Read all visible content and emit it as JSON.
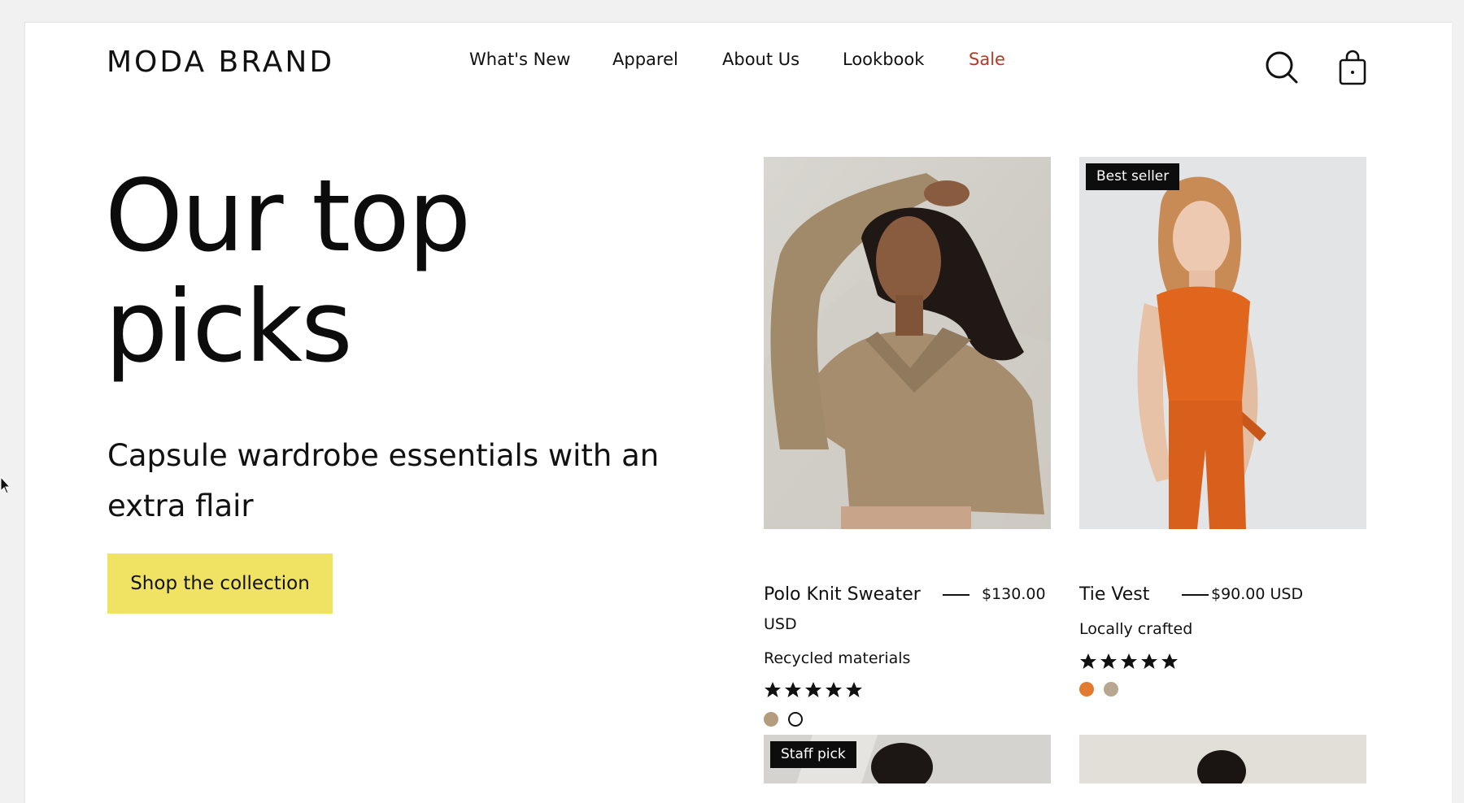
{
  "header": {
    "brand": "MODA BRAND",
    "nav": [
      {
        "label": "What's New"
      },
      {
        "label": "Apparel"
      },
      {
        "label": "About Us"
      },
      {
        "label": "Lookbook"
      },
      {
        "label": "Sale"
      }
    ],
    "icons": [
      "search-icon",
      "shopping-bag-icon"
    ]
  },
  "hero": {
    "title_line1": "Our top",
    "title_line2": "picks",
    "subtitle_line1": "Capsule wardrobe essentials with an",
    "subtitle_line2": "extra flair",
    "cta_label": "Shop the collection"
  },
  "products": [
    {
      "name": "Polo Knit Sweater",
      "price_line1": "$130.00",
      "price_line2": "USD",
      "note": "Recycled materials",
      "rating": 5,
      "swatches": [
        "#b49c7e",
        "#ffffff"
      ]
    },
    {
      "name": "Tie Vest",
      "badge": "Best seller",
      "price_line1": "$90.00 USD",
      "note": "Locally crafted",
      "rating": 5,
      "swatches": [
        "#e07b30",
        "#b9a690"
      ]
    },
    {
      "badge": "Staff pick"
    },
    {}
  ],
  "colors": {
    "accent_button": "#f0e263",
    "sale": "#b23a26",
    "badge_bg": "#0d0d0d"
  }
}
